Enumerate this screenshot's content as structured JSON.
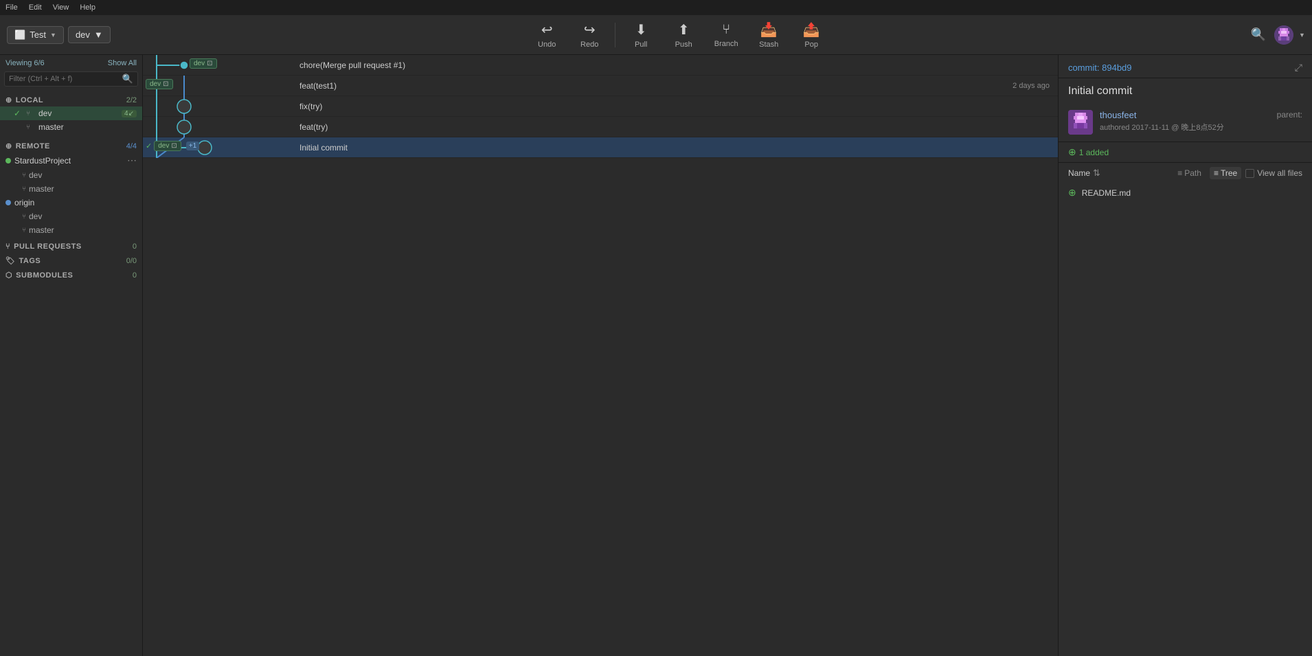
{
  "menubar": {
    "items": [
      "File",
      "Edit",
      "View",
      "Help"
    ]
  },
  "toolbar": {
    "repo_name": "Test",
    "branch_name": "dev",
    "undo_label": "Undo",
    "redo_label": "Redo",
    "pull_label": "Pull",
    "push_label": "Push",
    "branch_label": "Branch",
    "stash_label": "Stash",
    "pop_label": "Pop"
  },
  "sidebar": {
    "viewing_text": "Viewing 6/6",
    "show_all": "Show All",
    "filter_placeholder": "Filter (Ctrl + Alt + f)",
    "local": {
      "title": "LOCAL",
      "count": "2/2",
      "branches": [
        {
          "name": "dev",
          "active": true,
          "badge": "4↙"
        },
        {
          "name": "master",
          "active": false
        }
      ]
    },
    "remote": {
      "title": "REMOTE",
      "count": "4/4",
      "remotes": [
        {
          "name": "StardustProject",
          "active": true,
          "branches": [
            "dev",
            "master"
          ]
        },
        {
          "name": "origin",
          "active": false,
          "branches": [
            "dev",
            "master"
          ]
        }
      ]
    },
    "pull_requests": {
      "title": "PULL REQUESTS",
      "count": "0"
    },
    "tags": {
      "title": "TAGS",
      "count": "0/0"
    },
    "submodules": {
      "title": "SUBMODULES",
      "count": "0"
    }
  },
  "commits": [
    {
      "id": "c1",
      "branch_tag": "dev",
      "message": "chore(Merge pull request #1)",
      "time": "",
      "selected": false,
      "avatar": true
    },
    {
      "id": "c2",
      "branch_tag": "dev",
      "message": "feat(test1)",
      "time": "2 days ago",
      "selected": false,
      "avatar": true
    },
    {
      "id": "c3",
      "branch_tag": "",
      "message": "fix(try)",
      "time": "",
      "selected": false,
      "avatar": true
    },
    {
      "id": "c4",
      "branch_tag": "",
      "message": "feat(try)",
      "time": "",
      "selected": false,
      "avatar": true
    },
    {
      "id": "c5",
      "branch_tag": "dev",
      "extra_badge": "+1",
      "message": "Initial commit",
      "time": "",
      "selected": true,
      "avatar": true
    }
  ],
  "right_panel": {
    "commit_label": "commit:",
    "commit_hash": "894bd9",
    "commit_title": "Initial commit",
    "author_name": "thousfeet",
    "authored": "authored",
    "author_date": "2017-11-11 @ 晚上8点52分",
    "parent_label": "parent:",
    "added_count": "1 added",
    "name_col": "Name",
    "path_btn": "Path",
    "tree_btn": "Tree",
    "view_all_files": "View all files",
    "files": [
      {
        "name": "README.md",
        "status": "added"
      }
    ]
  }
}
